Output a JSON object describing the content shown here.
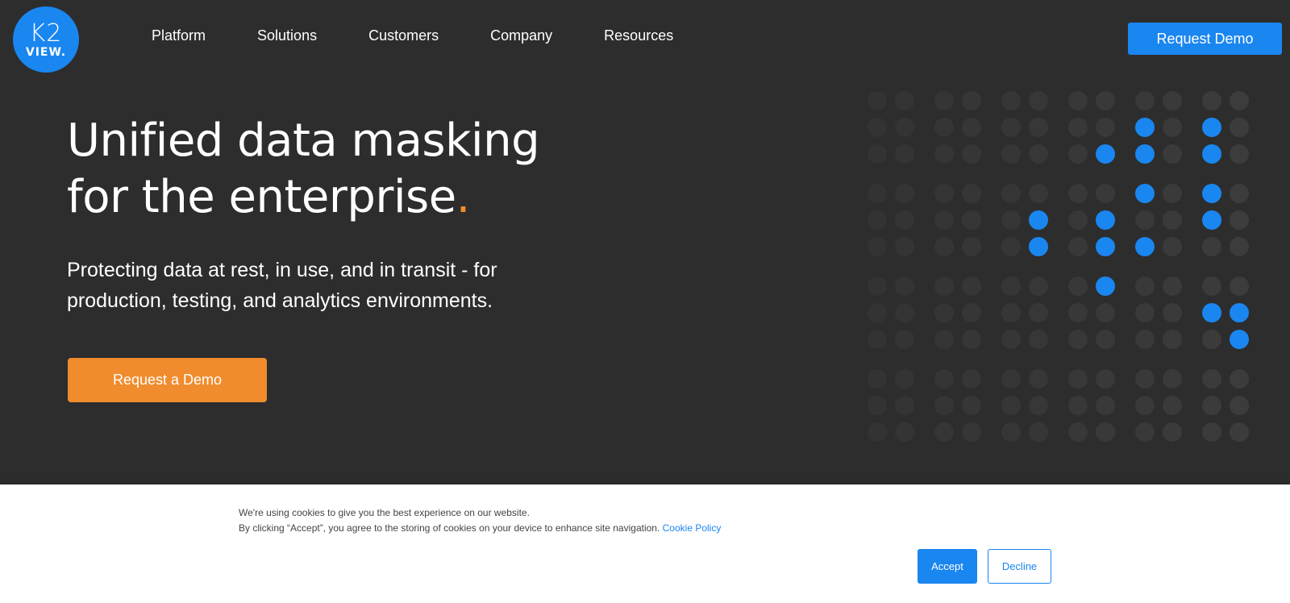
{
  "brand": {
    "line1": "K2",
    "line2": "VIEW."
  },
  "nav": {
    "items": [
      "Platform",
      "Solutions",
      "Customers",
      "Company",
      "Resources"
    ]
  },
  "header": {
    "cta_label": "Request Demo"
  },
  "hero": {
    "title_line1": "Unified data masking",
    "title_line2": "for the enterprise",
    "title_dot": ".",
    "subtitle_line1": "Protecting data at rest, in use, and in transit - for",
    "subtitle_line2": "production, testing, and analytics environments.",
    "cta_label": "Request a Demo"
  },
  "cookie": {
    "line1": "We're using cookies to give you the best experience on our website.",
    "line2": "By clicking “Accept”, you agree to the storing of cookies on your device to enhance site navigation.",
    "link": "Cookie Policy",
    "accept_label": "Accept",
    "decline_label": "Decline"
  },
  "colors": {
    "background": "#2d2d2d",
    "brand_blue": "#1a86f0",
    "accent_orange": "#f08c2e",
    "dot_gray": "#3c3c3c"
  },
  "decoration": {
    "highlighted_dots": [
      [
        1,
        8
      ],
      [
        1,
        10
      ],
      [
        1,
        12
      ],
      [
        1,
        15
      ],
      [
        2,
        7
      ],
      [
        2,
        8
      ],
      [
        2,
        10
      ],
      [
        2,
        12
      ],
      [
        2,
        13
      ],
      [
        2,
        15
      ],
      [
        3,
        8
      ],
      [
        3,
        10
      ],
      [
        3,
        12
      ],
      [
        3,
        15
      ],
      [
        4,
        5
      ],
      [
        4,
        7
      ],
      [
        4,
        10
      ],
      [
        4,
        13
      ],
      [
        4,
        15
      ],
      [
        5,
        5
      ],
      [
        5,
        7
      ],
      [
        5,
        8
      ],
      [
        5,
        12
      ],
      [
        5,
        15
      ],
      [
        6,
        7
      ],
      [
        6,
        15
      ],
      [
        7,
        10
      ],
      [
        7,
        11
      ],
      [
        7,
        12
      ],
      [
        7,
        15
      ],
      [
        8,
        11
      ],
      [
        8,
        15
      ],
      [
        9,
        15
      ]
    ]
  }
}
